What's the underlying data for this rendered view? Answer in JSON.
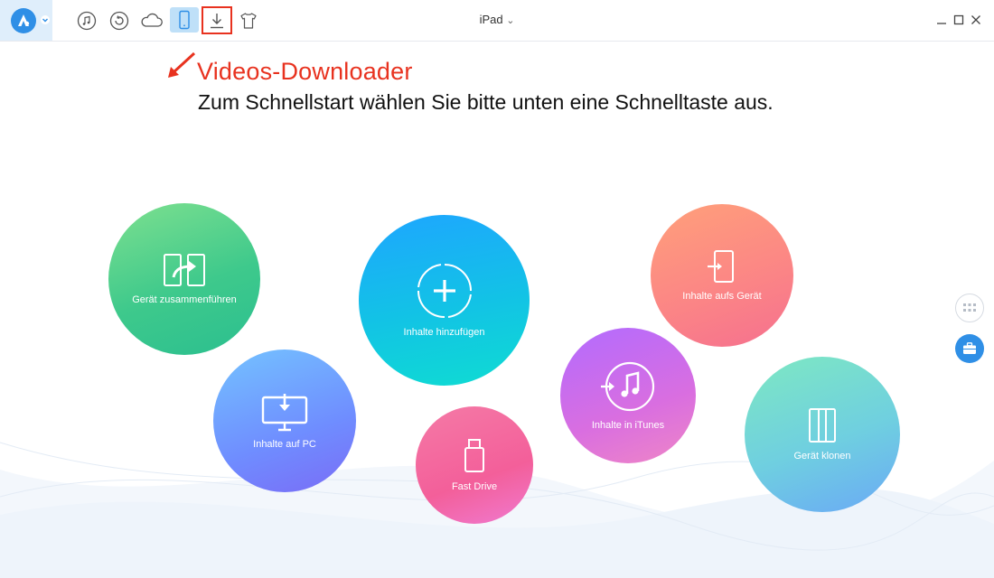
{
  "titlebar": {
    "device_label": "iPad",
    "device_caret": "⌄",
    "toolbar_icons": [
      "music-icon",
      "restore-icon",
      "cloud-icon",
      "phone-icon",
      "download-icon",
      "tshirt-icon"
    ],
    "window_controls": [
      "minimize-icon",
      "maximize-icon",
      "close-icon"
    ]
  },
  "annotation": {
    "label": "Videos-Downloader",
    "color": "#e8321f"
  },
  "instruction": "Zum Schnellstart wählen Sie bitte unten eine Schnelltaste aus.",
  "quick_actions": {
    "merge": "Gerät zusammenführen",
    "pc": "Inhalte auf PC",
    "add": "Inhalte hinzufügen",
    "fast_drive": "Fast Drive",
    "itunes": "Inhalte in iTunes",
    "to_device": "Inhalte aufs Gerät",
    "clone": "Gerät klonen"
  },
  "colors": {
    "brand": "#2f8fe6",
    "active_tab_bg": "#bfe0f8"
  }
}
